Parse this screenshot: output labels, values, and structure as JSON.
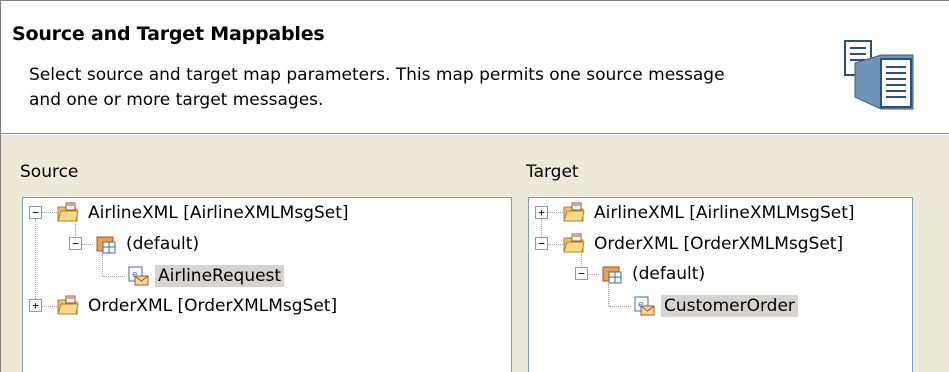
{
  "banner": {
    "title": "Source and Target Mappables",
    "description": "Select source and target map parameters. This map permits one source message and one or more target messages.",
    "icon": "mapping-wizard-icon"
  },
  "source": {
    "label": "Source",
    "nodes": [
      {
        "label": "AirlineXML [AirlineXMLMsgSet]",
        "icon": "message-set-folder-icon",
        "expander": "−"
      },
      {
        "label": "(default)",
        "icon": "namespace-icon",
        "expander": "−"
      },
      {
        "label": "AirlineRequest",
        "icon": "message-icon",
        "selected": true
      },
      {
        "label": "OrderXML [OrderXMLMsgSet]",
        "icon": "message-set-folder-icon",
        "expander": "+"
      }
    ]
  },
  "target": {
    "label": "Target",
    "nodes": [
      {
        "label": "AirlineXML [AirlineXMLMsgSet]",
        "icon": "message-set-folder-icon",
        "expander": "+"
      },
      {
        "label": "OrderXML [OrderXMLMsgSet]",
        "icon": "message-set-folder-icon",
        "expander": "−"
      },
      {
        "label": "(default)",
        "icon": "namespace-icon",
        "expander": "−"
      },
      {
        "label": "CustomerOrder",
        "icon": "message-icon",
        "selected": true
      }
    ]
  },
  "colors": {
    "panel_background": "#ece9d8",
    "selection_background": "#d6d3ce",
    "tree_border": "#7f9db9"
  }
}
